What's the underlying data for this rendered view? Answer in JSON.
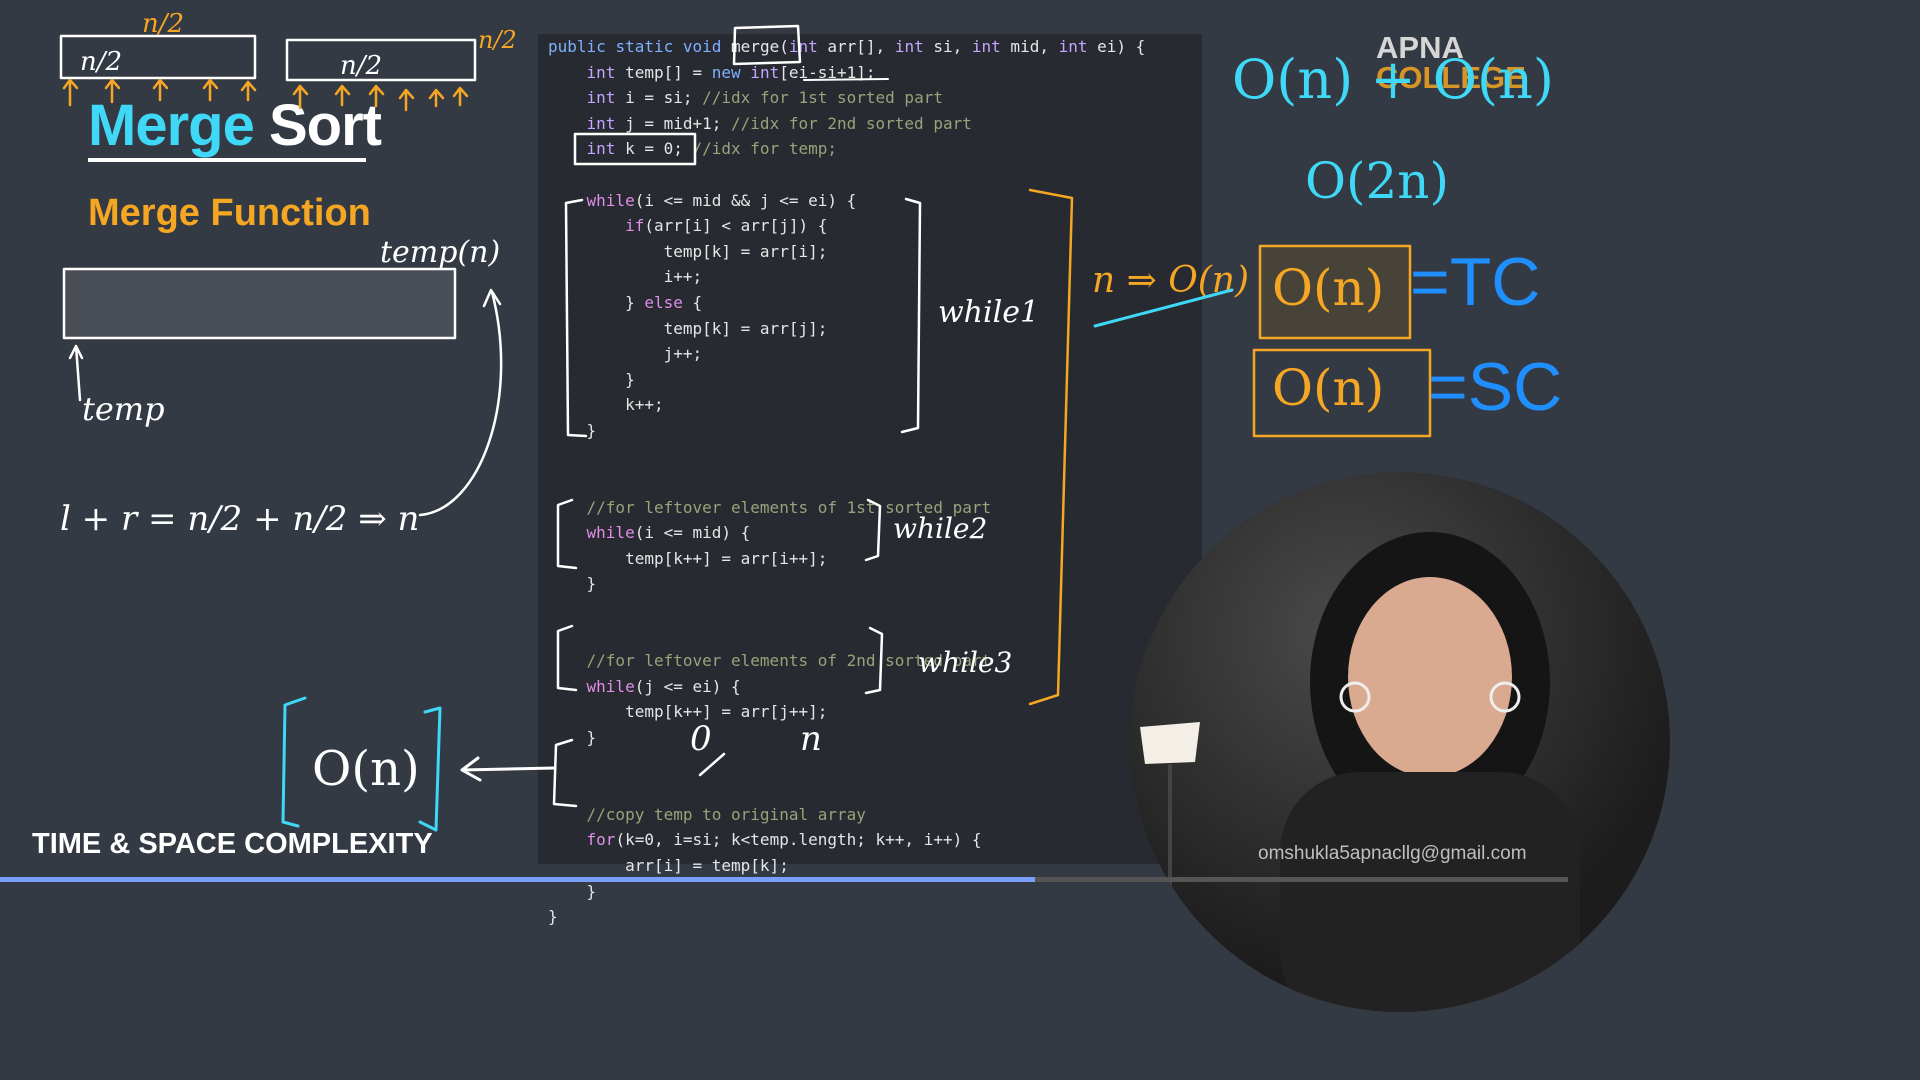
{
  "slide": {
    "title_word1": "Merge",
    "title_word2": "Sort",
    "subtitle": "Merge Function",
    "footer": "TIME & SPACE COMPLEXITY"
  },
  "code_lines": [
    "public static void merge(int arr[], int si, int mid, int ei) {",
    "    int temp[] = new int[ei-si+1];",
    "    int i = si; //idx for 1st sorted part",
    "    int j = mid+1; //idx for 2nd sorted part",
    "    int k = 0; //idx for temp;",
    "",
    "    while(i <= mid && j <= ei) {",
    "        if(arr[i] < arr[j]) {",
    "            temp[k] = arr[i];",
    "            i++;",
    "        } else {",
    "            temp[k] = arr[j];",
    "            j++;",
    "        }",
    "        k++;",
    "    }",
    "",
    "",
    "    //for leftover elements of 1st sorted part",
    "    while(i <= mid) {",
    "        temp[k++] = arr[i++];",
    "    }",
    "",
    "",
    "    //for leftover elements of 2nd sorted part",
    "    while(j <= ei) {",
    "        temp[k++] = arr[j++];",
    "    }",
    "",
    "",
    "    //copy temp to original array",
    "    for(k=0, i=si; k<temp.length; k++, i++) {",
    "        arr[i] = temp[k];",
    "    }",
    "}"
  ],
  "annotations": {
    "left_half": "n/2",
    "right_half": "n/2",
    "temp_label": "temp",
    "temp_n": "temp(n)",
    "sum_eq": "l + r = n/2 + n/2 ⇒ n",
    "copy_cost": "O(n)",
    "while1": "while1",
    "while2": "while2",
    "while3": "while3",
    "n_arrow": "n ⇒ O(n)",
    "top_right_1": "O(n) + O(n)",
    "top_right_2": "O(2n)",
    "tc_box": "O(n)",
    "tc": "=TC",
    "sc_box": "O(n)",
    "sc": "=SC"
  },
  "logo": {
    "line1": "APNA",
    "line2": "COLLEGE"
  },
  "email": "omshukla5apnacllg@gmail.com",
  "video_progress": 0.66,
  "colors": {
    "cyan": "#3fd8f6",
    "orange": "#f5a623",
    "blue": "#1f8fff",
    "white": "#ffffff"
  }
}
